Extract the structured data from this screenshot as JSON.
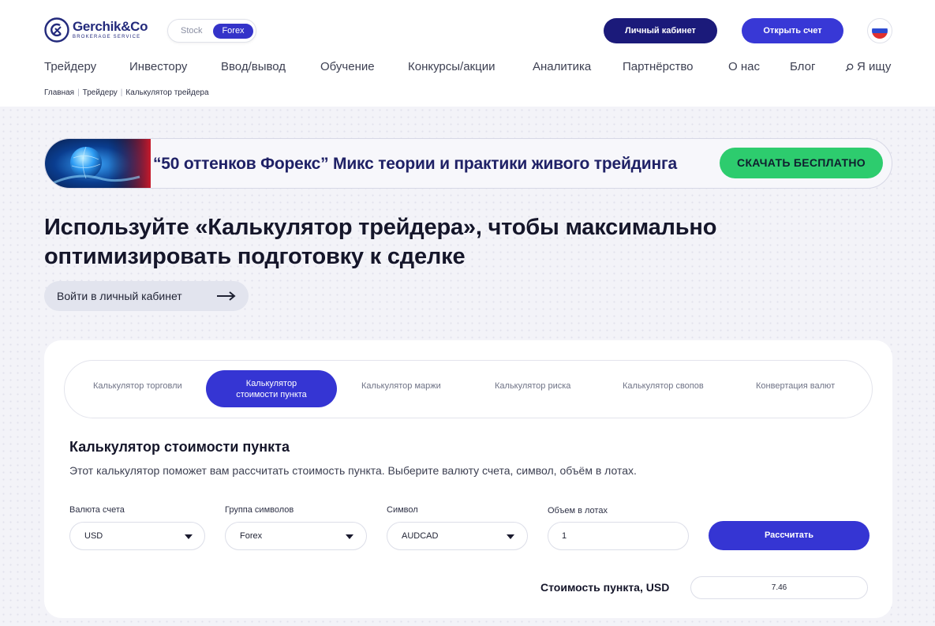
{
  "header": {
    "logo": {
      "name": "Gerchik&Co",
      "subtitle": "BROKERAGE SERVICE"
    },
    "market_toggle": {
      "options": [
        "Stock",
        "Forex"
      ],
      "selected": "Forex"
    },
    "cabinet_button": "Личный кабинет",
    "open_account_button": "Открыть счет",
    "language_flag": "flag-ru-icon",
    "nav": [
      "Трейдеру",
      "Инвестору",
      "Ввод/вывод",
      "Обучение",
      "Конкурсы/акции",
      "Аналитика",
      "Партнёрство",
      "О нас",
      "Блог"
    ],
    "search_label": "Я ищу",
    "breadcrumb": [
      "Главная",
      "Трейдеру",
      "Калькулятор трейдера"
    ]
  },
  "banner": {
    "text": "“50 оттенков Форекс” Микс теории и практики живого трейдинга",
    "button": "СКАЧАТЬ БЕСПЛАТНО"
  },
  "hero": {
    "headline_line1": "Используйте «Калькулятор трейдера», чтобы максимально",
    "headline_line2": "оптимизировать подготовку к сделке",
    "login_button": "Войти в личный кабинет"
  },
  "calculator": {
    "tabs": [
      "Калькулятор торговли",
      "Калькулятор стоимости пункта",
      "Калькулятор маржи",
      "Калькулятор риска",
      "Калькулятор свопов",
      "Конвертация валют"
    ],
    "active_tab_line1": "Калькулятор",
    "active_tab_line2": "стоимости пункта",
    "title": "Калькулятор стоимости пункта",
    "description": "Этот калькулятор поможет вам рассчитать стоимость пункта. Выберите валюту счета, символ, объём в лотах.",
    "fields": {
      "currency": {
        "label": "Валюта счета",
        "value": "USD"
      },
      "symbol_group": {
        "label": "Группа символов",
        "value": "Forex"
      },
      "symbol": {
        "label": "Символ",
        "value": "AUDCAD"
      },
      "lots": {
        "label": "Объем в лотах",
        "value": "1"
      }
    },
    "calculate_button": "Рассчитать",
    "result_label": "Стоимость пункта, USD",
    "result_value": "7.46"
  },
  "colors": {
    "primary": "#3535d3",
    "dark_button": "#1b1a7a",
    "green_button": "#2dcc6e",
    "logo": "#232a7c"
  }
}
